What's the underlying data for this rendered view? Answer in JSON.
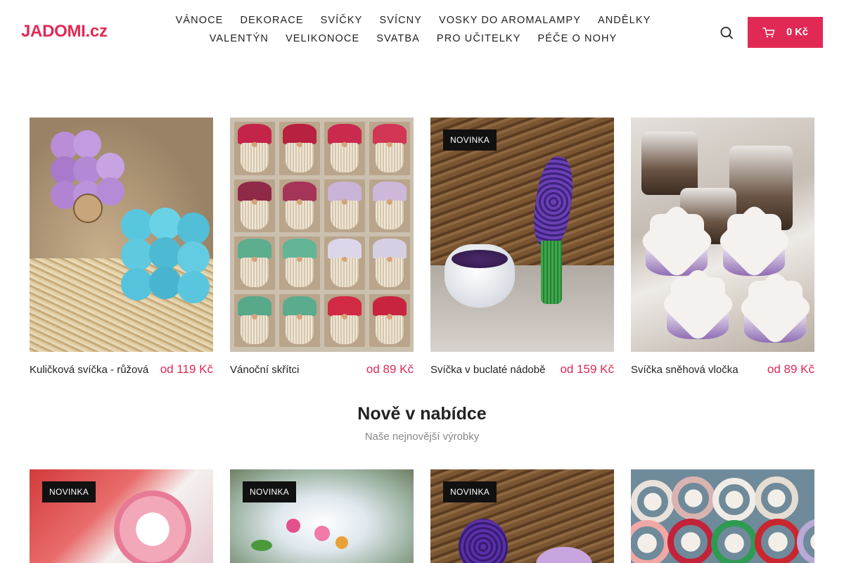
{
  "site": {
    "logo": "JADOMI.cz"
  },
  "nav": {
    "items": [
      "VÁNOCE",
      "DEKORACE",
      "SVÍČKY",
      "SVÍCNY",
      "VOSKY DO AROMALAMPY",
      "ANDĚLKY",
      "VALENTÝN",
      "VELIKONOCE",
      "SVATBA",
      "PRO UČITELKY",
      "PÉČE O NOHY"
    ]
  },
  "cart": {
    "amount": "0 Kč"
  },
  "colors": {
    "accent": "#e02a55",
    "badge": "#111111"
  },
  "icons": {
    "search": "search-icon",
    "cart": "cart-icon"
  },
  "products_top": [
    {
      "name": "Kuličková svíčka - růžová",
      "price": "od 119 Kč",
      "badge": ""
    },
    {
      "name": "Vánoční skřítci",
      "price": "od 89 Kč",
      "badge": ""
    },
    {
      "name": "Svíčka v buclaté nádobě",
      "price": "od 159 Kč",
      "badge": "NOVINKA"
    },
    {
      "name": "Svíčka sněhová vločka",
      "price": "od 89 Kč",
      "badge": ""
    }
  ],
  "section": {
    "title": "Nově v nabídce",
    "subtitle": "Naše nejnovější výrobky"
  },
  "products_new": [
    {
      "badge": "NOVINKA"
    },
    {
      "badge": "NOVINKA"
    },
    {
      "badge": "NOVINKA"
    },
    {
      "badge": ""
    }
  ]
}
